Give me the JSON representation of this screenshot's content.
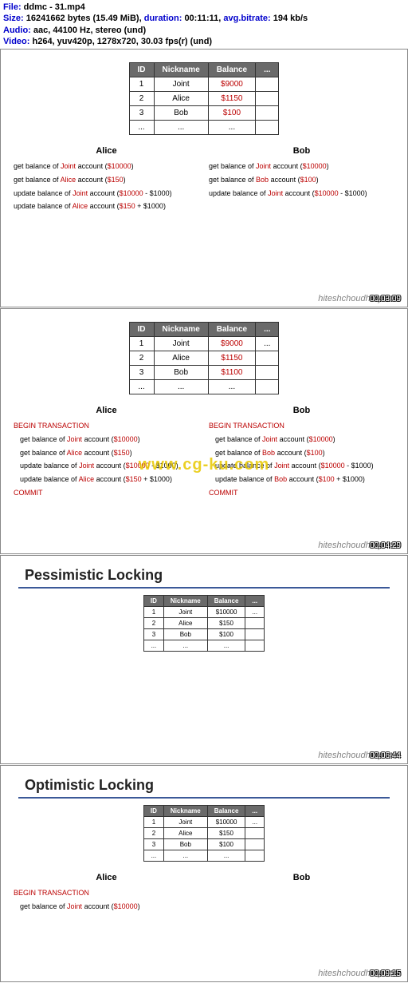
{
  "header": {
    "l1a": "File: ",
    "l1b": "ddmc - 31.mp4",
    "l2a": "Size: ",
    "l2b": "16241662 bytes (15.49 MiB), ",
    "l2c": "duration: ",
    "l2d": "00:11:11, ",
    "l2e": "avg.bitrate: ",
    "l2f": "194 kb/s",
    "l3a": "Audio: ",
    "l3b": "aac, 44100 Hz, stereo (und)",
    "l4a": "Video: ",
    "l4b": "h264, yuv420p, 1278x720, 30.03 fps(r) (und)"
  },
  "tableHeaders": {
    "id": "ID",
    "nick": "Nickname",
    "bal": "Balance",
    "more": "..."
  },
  "frame1": {
    "rows": [
      {
        "id": "1",
        "nick": "Joint",
        "bal": "$9000",
        "more": ""
      },
      {
        "id": "2",
        "nick": "Alice",
        "bal": "$1150",
        "more": ""
      },
      {
        "id": "3",
        "nick": "Bob",
        "bal": "$100",
        "more": ""
      },
      {
        "id": "...",
        "nick": "...",
        "bal": "...",
        "more": ""
      }
    ],
    "aliceHead": "Alice",
    "bobHead": "Bob",
    "alice": {
      "l1a": "get balance of ",
      "l1b": "Joint",
      "l1c": " account (",
      "l1d": "$10000",
      "l1e": ")",
      "l2a": "get balance of ",
      "l2b": "Alice",
      "l2c": " account (",
      "l2d": "$150",
      "l2e": ")",
      "l3a": "update balance of ",
      "l3b": "Joint",
      "l3c": " account (",
      "l3d": "$10000",
      "l3e": " - $1000)",
      "l4a": "update balance of ",
      "l4b": "Alice",
      "l4c": " account (",
      "l4d": "$150",
      "l4e": " + $1000)"
    },
    "bob": {
      "l1a": "get balance of ",
      "l1b": "Joint",
      "l1c": " account (",
      "l1d": "$10000",
      "l1e": ")",
      "l2a": "get balance of ",
      "l2b": "Bob",
      "l2c": " account (",
      "l2d": "$100",
      "l2e": ")",
      "l3a": "update balance of ",
      "l3b": "Joint",
      "l3c": " account (",
      "l3d": "$10000",
      "l3e": " - $1000)"
    },
    "wm": "hiteshchoudhary.com",
    "ts": "00:03:09"
  },
  "frame2": {
    "rows": [
      {
        "id": "1",
        "nick": "Joint",
        "bal": "$9000",
        "more": "..."
      },
      {
        "id": "2",
        "nick": "Alice",
        "bal": "$1150",
        "more": ""
      },
      {
        "id": "3",
        "nick": "Bob",
        "bal": "$1100",
        "more": ""
      },
      {
        "id": "...",
        "nick": "...",
        "bal": "...",
        "more": ""
      }
    ],
    "aliceHead": "Alice",
    "bobHead": "Bob",
    "begin": "BEGIN TRANSACTION",
    "commit": "COMMIT",
    "alice": {
      "l1a": "get balance of ",
      "l1b": "Joint",
      "l1c": " account (",
      "l1d": "$10000",
      "l1e": ")",
      "l2a": "get balance of ",
      "l2b": "Alice",
      "l2c": " account (",
      "l2d": "$150",
      "l2e": ")",
      "l3a": "update balance of ",
      "l3b": "Joint",
      "l3c": " account (",
      "l3d": "$10000",
      "l3e": " - $1000)",
      "l4a": "update balance of ",
      "l4b": "Alice",
      "l4c": " account (",
      "l4d": "$150",
      "l4e": " + $1000)"
    },
    "bob": {
      "l1a": "get balance of ",
      "l1b": "Joint",
      "l1c": " account (",
      "l1d": "$10000",
      "l1e": ")",
      "l2a": "get balance of ",
      "l2b": "Bob",
      "l2c": " account (",
      "l2d": "$100",
      "l2e": ")",
      "l3a": "update balance of ",
      "l3b": "Joint",
      "l3c": " account (",
      "l3d": "$10000",
      "l3e": " - $1000)",
      "l4a": "update balance of ",
      "l4b": "Bob",
      "l4c": " account (",
      "l4d": "$100",
      "l4e": " + $1000)"
    },
    "cg": "www.cg-ku.com",
    "wm": "hiteshchoudhary.com",
    "ts": "00:04:29"
  },
  "frame3": {
    "title": "Pessimistic Locking",
    "rows": [
      {
        "id": "1",
        "nick": "Joint",
        "bal": "$10000",
        "more": "..."
      },
      {
        "id": "2",
        "nick": "Alice",
        "bal": "$150",
        "more": ""
      },
      {
        "id": "3",
        "nick": "Bob",
        "bal": "$100",
        "more": ""
      },
      {
        "id": "...",
        "nick": "...",
        "bal": "...",
        "more": ""
      }
    ],
    "wm": "hiteshchoudhary.com",
    "ts": "00:06:44"
  },
  "frame4": {
    "title": "Optimistic Locking",
    "rows": [
      {
        "id": "1",
        "nick": "Joint",
        "bal": "$10000",
        "more": "..."
      },
      {
        "id": "2",
        "nick": "Alice",
        "bal": "$150",
        "more": ""
      },
      {
        "id": "3",
        "nick": "Bob",
        "bal": "$100",
        "more": ""
      },
      {
        "id": "...",
        "nick": "...",
        "bal": "...",
        "more": ""
      }
    ],
    "aliceHead": "Alice",
    "bobHead": "Bob",
    "begin": "BEGIN TRANSACTION",
    "alice": {
      "l1a": "get balance of ",
      "l1b": "Joint",
      "l1c": " account (",
      "l1d": "$10000",
      "l1e": ")"
    },
    "wm": "hiteshchoudhary.com",
    "ts": "00:09:15"
  }
}
